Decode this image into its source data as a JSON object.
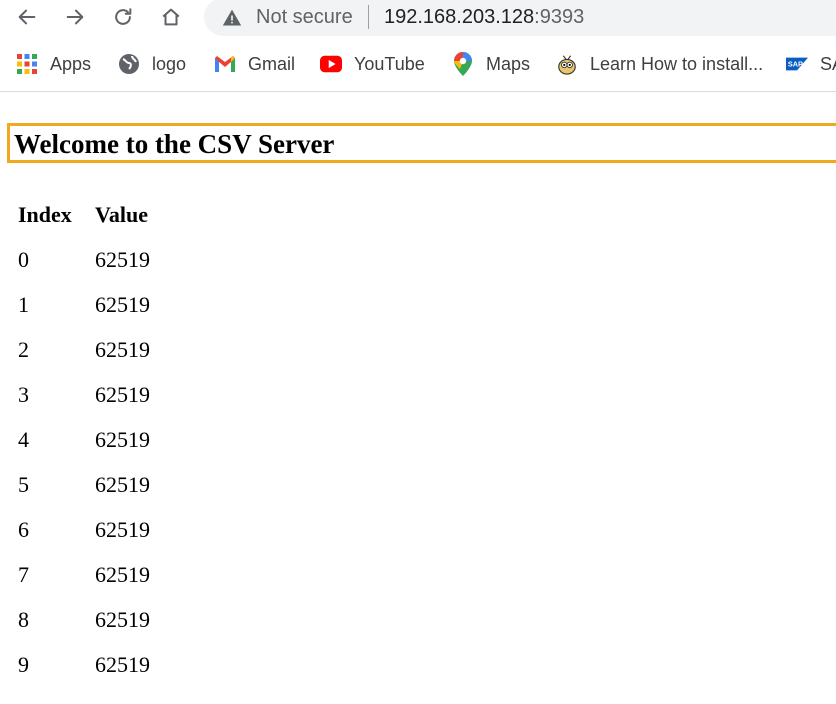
{
  "browser": {
    "security_label": "Not secure",
    "url_host": "192.168.203.128",
    "url_port": ":9393"
  },
  "bookmarks": [
    {
      "label": "Apps",
      "icon": "apps-grid-icon"
    },
    {
      "label": "logo",
      "icon": "globe-icon"
    },
    {
      "label": "Gmail",
      "icon": "gmail-icon"
    },
    {
      "label": "YouTube",
      "icon": "youtube-icon"
    },
    {
      "label": "Maps",
      "icon": "maps-pin-icon"
    },
    {
      "label": "Learn How to install...",
      "icon": "bee-icon"
    },
    {
      "label": "SA",
      "icon": "sap-icon"
    }
  ],
  "page": {
    "title": "Welcome to the CSV Server",
    "table": {
      "headers": [
        "Index",
        "Value"
      ],
      "rows": [
        [
          "0",
          "62519"
        ],
        [
          "1",
          "62519"
        ],
        [
          "2",
          "62519"
        ],
        [
          "3",
          "62519"
        ],
        [
          "4",
          "62519"
        ],
        [
          "5",
          "62519"
        ],
        [
          "6",
          "62519"
        ],
        [
          "7",
          "62519"
        ],
        [
          "8",
          "62519"
        ],
        [
          "9",
          "62519"
        ]
      ]
    }
  },
  "colors": {
    "heading_border": "#f0a81c",
    "omnibox_bg": "#f1f3f4",
    "youtube_red": "#ff0000"
  }
}
